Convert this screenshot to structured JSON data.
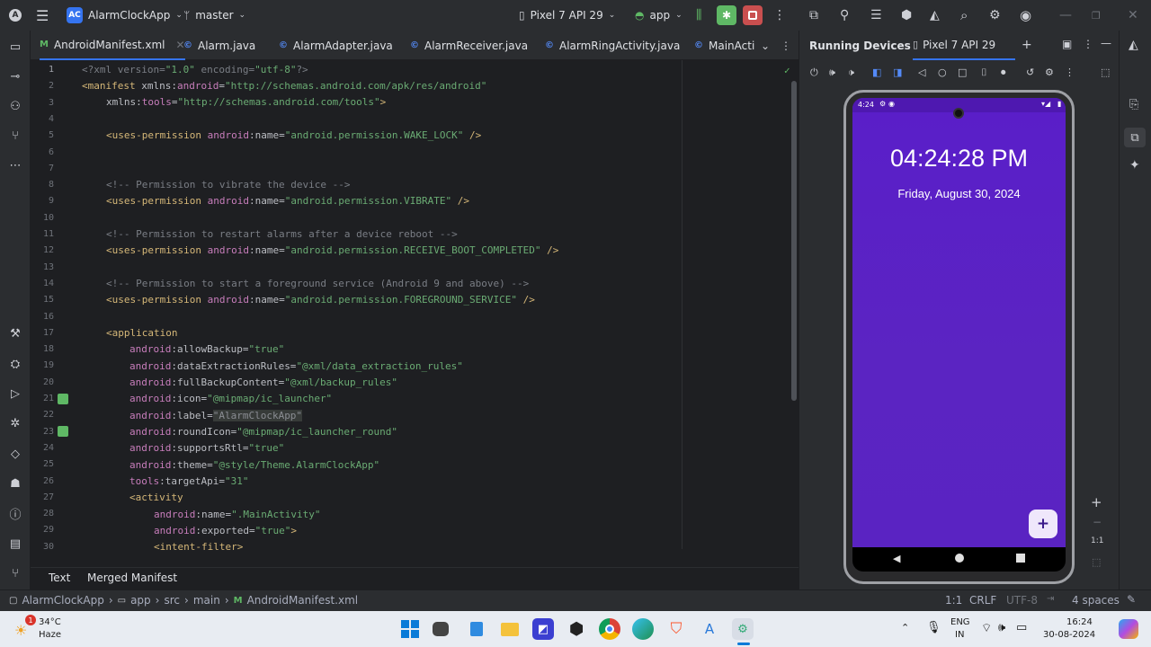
{
  "titlebar": {
    "project_badge": "AC",
    "project_name": "AlarmClockApp",
    "branch": "master",
    "device": "Pixel 7 API 29",
    "run_config": "app"
  },
  "tabs": [
    {
      "label": "AndroidManifest.xml",
      "icon": "M"
    },
    {
      "label": "Alarm.java",
      "icon": "©"
    },
    {
      "label": "AlarmAdapter.java",
      "icon": "©"
    },
    {
      "label": "AlarmReceiver.java",
      "icon": "©"
    },
    {
      "label": "AlarmRingActivity.java",
      "icon": "©"
    },
    {
      "label": "MainActi",
      "icon": "©"
    }
  ],
  "editor": {
    "lines": [
      "1",
      "2",
      "3",
      "4",
      "5",
      "6",
      "7",
      "8",
      "9",
      "10",
      "11",
      "12",
      "13",
      "14",
      "15",
      "16",
      "17",
      "18",
      "19",
      "20",
      "21",
      "22",
      "23",
      "24",
      "25",
      "26",
      "27",
      "28",
      "29",
      "30"
    ],
    "code": {
      "l1_a": "<?xml version=",
      "l1_b": "\"1.0\"",
      "l1_c": " encoding=",
      "l1_d": "\"utf-8\"",
      "l1_e": "?>",
      "l2_a": "<manifest ",
      "l2_b": "xmlns:",
      "l2_c": "android",
      "l2_d": "=",
      "l2_e": "\"http://schemas.android.com/apk/res/android\"",
      "l3_a": "xmlns:",
      "l3_b": "tools",
      "l3_c": "=",
      "l3_d": "\"http://schemas.android.com/tools\"",
      "l3_e": ">",
      "l5_a": "<uses-permission ",
      "l5_b": "android",
      "l5_c": ":name=",
      "l5_d": "\"android.permission.WAKE_LOCK\"",
      "l5_e": " />",
      "l8": "<!-- Permission to vibrate the device -->",
      "l9_a": "<uses-permission ",
      "l9_b": "android",
      "l9_c": ":name=",
      "l9_d": "\"android.permission.VIBRATE\"",
      "l9_e": " />",
      "l11": "<!-- Permission to restart alarms after a device reboot -->",
      "l12_a": "<uses-permission ",
      "l12_b": "android",
      "l12_c": ":name=",
      "l12_d": "\"android.permission.RECEIVE_BOOT_COMPLETED\"",
      "l12_e": " />",
      "l14": "<!-- Permission to start a foreground service (Android 9 and above) -->",
      "l15_a": "<uses-permission ",
      "l15_b": "android",
      "l15_c": ":name=",
      "l15_d": "\"android.permission.FOREGROUND_SERVICE\"",
      "l15_e": " />",
      "l17": "<application",
      "l18_a": "android",
      "l18_b": ":allowBackup=",
      "l18_c": "\"true\"",
      "l19_a": "android",
      "l19_b": ":dataExtractionRules=",
      "l19_c": "\"@xml/data_extraction_rules\"",
      "l20_a": "android",
      "l20_b": ":fullBackupContent=",
      "l20_c": "\"@xml/backup_rules\"",
      "l21_a": "android",
      "l21_b": ":icon=",
      "l21_c": "\"@mipmap/ic_launcher\"",
      "l22_a": "android",
      "l22_b": ":label=",
      "l22_c": "\"AlarmClockApp\"",
      "l23_a": "android",
      "l23_b": ":roundIcon=",
      "l23_c": "\"@mipmap/ic_launcher_round\"",
      "l24_a": "android",
      "l24_b": ":supportsRtl=",
      "l24_c": "\"true\"",
      "l25_a": "android",
      "l25_b": ":theme=",
      "l25_c": "\"@style/Theme.AlarmClockApp\"",
      "l26_a": "tools",
      "l26_b": ":targetApi=",
      "l26_c": "\"31\"",
      "l27": "<activity",
      "l28_a": "android",
      "l28_b": ":name=",
      "l28_c": "\".MainActivity\"",
      "l29_a": "android",
      "l29_b": ":exported=",
      "l29_c": "\"true\"",
      "l29_d": ">",
      "l30": "<intent-filter>"
    },
    "bottom_tabs": [
      "Text",
      "Merged Manifest"
    ]
  },
  "running_devices": {
    "title": "Running Devices",
    "device_tab": "Pixel 7 API 29",
    "zoom_label": "1:1"
  },
  "phone": {
    "status_time": "4:24",
    "clock": "04:24:28 PM",
    "date": "Friday, August 30, 2024",
    "fab": "+"
  },
  "statusbar": {
    "breadcrumb": [
      "AlarmClockApp",
      "app",
      "src",
      "main",
      "AndroidManifest.xml"
    ],
    "position": "1:1",
    "line_sep": "CRLF",
    "encoding": "UTF-8",
    "indent": "4 spaces"
  },
  "taskbar": {
    "weather_temp": "34°C",
    "weather_desc": "Haze",
    "weather_badge": "1",
    "lang_1": "ENG",
    "lang_2": "IN",
    "time": "16:24",
    "date": "30-08-2024"
  },
  "colors": {
    "accent": "#3574f0",
    "phone_bg": "#5a1ec9",
    "debug_green": "#5fb865",
    "stop_red": "#c94f4f"
  }
}
